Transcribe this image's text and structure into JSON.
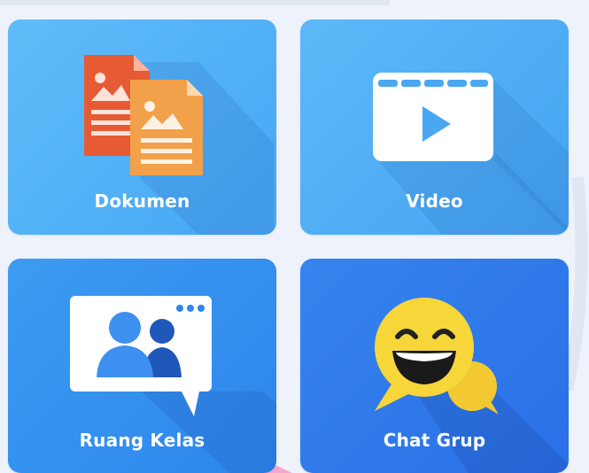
{
  "tiles": [
    {
      "label": "Dokumen",
      "icon": "document-icon",
      "color": "#4eaff5"
    },
    {
      "label": "Video",
      "icon": "video-player-icon",
      "color": "#4eaff5"
    },
    {
      "label": "Ruang Kelas",
      "icon": "classroom-icon",
      "color": "#348fef"
    },
    {
      "label": "Chat Grup",
      "icon": "chat-emoji-icon",
      "color": "#2f78ea"
    }
  ]
}
